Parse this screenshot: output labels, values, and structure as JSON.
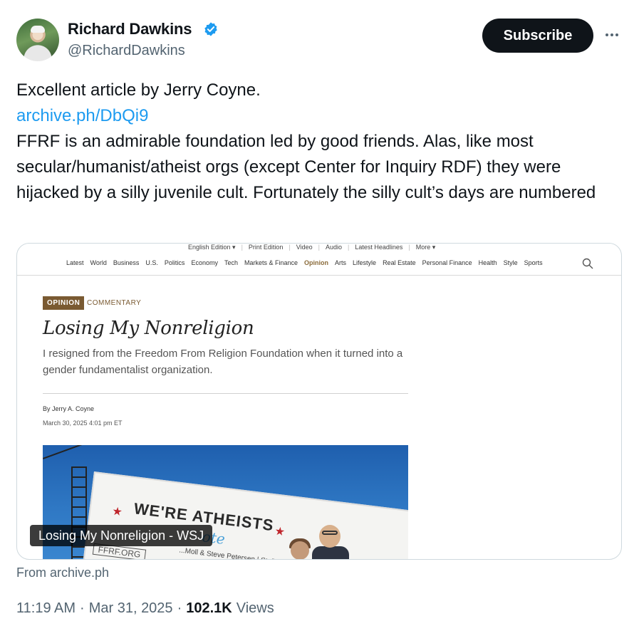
{
  "author": {
    "display_name": "Richard Dawkins",
    "handle": "@RichardDawkins",
    "verified": true,
    "verified_color": "#1d9bf0"
  },
  "actions": {
    "subscribe_label": "Subscribe",
    "more_icon": "ellipsis-icon"
  },
  "tweet": {
    "line1": "Excellent article by Jerry Coyne.",
    "link": "archive.ph/DbQi9",
    "body": "FFRF is an admirable foundation led by good friends. Alas, like most secular/humanist/atheist orgs (except Center for Inquiry RDF) they were hijacked by a silly juvenile cult. Fortunately the silly cult’s days are numbered"
  },
  "card": {
    "label": "Losing My Nonreligion - WSJ",
    "source": "From archive.ph",
    "wsj": {
      "top_links": [
        "English Edition ▾",
        "Print Edition",
        "Video",
        "Audio",
        "Latest Headlines",
        "More ▾"
      ],
      "nav": [
        "Latest",
        "World",
        "Business",
        "U.S.",
        "Politics",
        "Economy",
        "Tech",
        "Markets & Finance",
        "Opinion",
        "Arts",
        "Lifestyle",
        "Real Estate",
        "Personal Finance",
        "Health",
        "Style",
        "Sports"
      ],
      "active_nav": "Opinion",
      "badge": "OPINION",
      "section": "COMMENTARY",
      "headline": "Losing My Nonreligion",
      "dek": "I resigned from the Freedom From Religion Foundation when it turned into a gender fundamentalist organization.",
      "byline": "By Jerry A. Coyne",
      "date": "March 30, 2025 4:01 pm ET",
      "photo_text": "WE'RE ATHEISTS",
      "photo_script": "ote",
      "photo_sub": "...Moll & Steve Petersen | St. Paul",
      "photo_sub2": "FFRF.ORG"
    }
  },
  "meta": {
    "time": "11:19 AM",
    "sep1": "·",
    "date": "Mar 31, 2025",
    "sep2": "·",
    "views_count": "102.1K",
    "views_label": "Views"
  }
}
